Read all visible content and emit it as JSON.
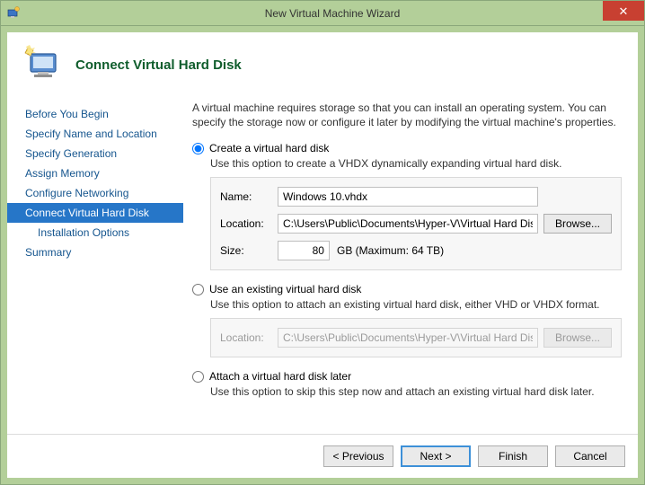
{
  "window": {
    "title": "New Virtual Machine Wizard",
    "close_glyph": "✕"
  },
  "header": {
    "title": "Connect Virtual Hard Disk"
  },
  "sidebar": {
    "items": [
      {
        "label": "Before You Begin"
      },
      {
        "label": "Specify Name and Location"
      },
      {
        "label": "Specify Generation"
      },
      {
        "label": "Assign Memory"
      },
      {
        "label": "Configure Networking"
      },
      {
        "label": "Connect Virtual Hard Disk"
      },
      {
        "label": "Installation Options"
      },
      {
        "label": "Summary"
      }
    ]
  },
  "main": {
    "intro": "A virtual machine requires storage so that you can install an operating system. You can specify the storage now or configure it later by modifying the virtual machine's properties.",
    "opt1": {
      "label": "Create a virtual hard disk",
      "desc": "Use this option to create a VHDX dynamically expanding virtual hard disk.",
      "name_label": "Name:",
      "name_value": "Windows 10.vhdx",
      "loc_label": "Location:",
      "loc_value": "C:\\Users\\Public\\Documents\\Hyper-V\\Virtual Hard Disks\\",
      "browse_label": "Browse...",
      "size_label": "Size:",
      "size_value": "80",
      "size_unit": "GB (Maximum: 64 TB)"
    },
    "opt2": {
      "label": "Use an existing virtual hard disk",
      "desc": "Use this option to attach an existing virtual hard disk, either VHD or VHDX format.",
      "loc_label": "Location:",
      "loc_value": "C:\\Users\\Public\\Documents\\Hyper-V\\Virtual Hard Disks\\",
      "browse_label": "Browse..."
    },
    "opt3": {
      "label": "Attach a virtual hard disk later",
      "desc": "Use this option to skip this step now and attach an existing virtual hard disk later."
    }
  },
  "footer": {
    "previous": "< Previous",
    "next": "Next >",
    "finish": "Finish",
    "cancel": "Cancel"
  }
}
